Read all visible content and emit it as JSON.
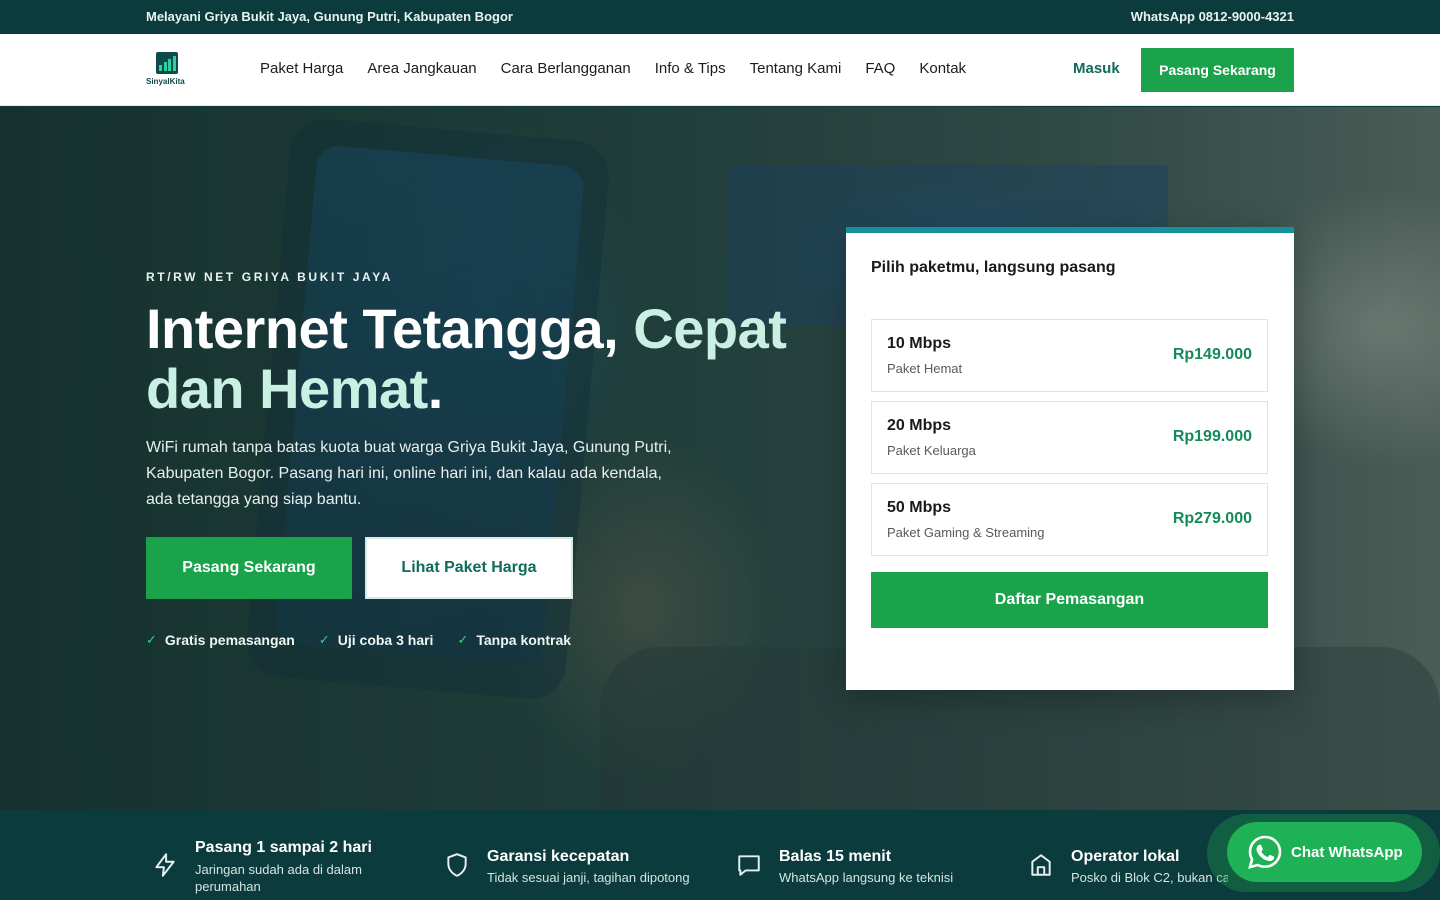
{
  "topbar": {
    "location": "Melayani Griya Bukit Jaya, Gunung Putri, Kabupaten Bogor",
    "contact": "WhatsApp 0812-9000-4321"
  },
  "header": {
    "brand": "SinyalKita",
    "nav": [
      "Paket Harga",
      "Area Jangkauan",
      "Cara Berlangganan",
      "Info & Tips",
      "Tentang Kami",
      "FAQ",
      "Kontak"
    ],
    "login_label": "Masuk",
    "cta_label": "Pasang Sekarang"
  },
  "hero": {
    "eyebrow": "RT/RW NET GRIYA BUKIT JAYA",
    "headline_a": "Internet Tetangga",
    "headline_comma": ",",
    "headline_accent": "Cepat",
    "headline_b": "dan Hemat",
    "headline_dot": ".",
    "lead": "WiFi rumah tanpa batas kuota buat warga Griya Bukit Jaya, Gunung Putri, Kabupaten Bogor. Pasang hari ini, online hari ini, dan kalau ada kendala, ada tetangga yang siap bantu.",
    "primary_cta": "Pasang Sekarang",
    "secondary_cta": "Lihat Paket Harga",
    "checks": [
      "Gratis pemasangan",
      "Uji coba 3 hari",
      "Tanpa kontrak"
    ]
  },
  "plans_card": {
    "title": "Pilih paketmu, langsung pasang",
    "plans": [
      {
        "speed": "10 Mbps",
        "name": "Paket Hemat",
        "price": "Rp149.000"
      },
      {
        "speed": "20 Mbps",
        "name": "Paket Keluarga",
        "price": "Rp199.000"
      },
      {
        "speed": "50 Mbps",
        "name": "Paket Gaming & Streaming",
        "price": "Rp279.000"
      }
    ],
    "cta": "Daftar Pemasangan"
  },
  "features": [
    {
      "icon": "lightning-icon",
      "title": "Pasang 1 sampai 2 hari",
      "desc": "Jaringan sudah ada di dalam perumahan"
    },
    {
      "icon": "shield-icon",
      "title": "Garansi kecepatan",
      "desc": "Tidak sesuai janji, tagihan dipotong"
    },
    {
      "icon": "chat-bubble-icon",
      "title": "Balas 15 menit",
      "desc": "WhatsApp langsung ke teknisi"
    },
    {
      "icon": "home-icon",
      "title": "Operator lokal",
      "desc": "Posko di Blok C2, bukan call"
    }
  ],
  "whatsapp": {
    "label": "Chat WhatsApp",
    "icon": "whatsapp-icon"
  },
  "colors": {
    "primary_green": "#1aa34a",
    "dark_teal": "#0c3b3d",
    "accent_mint": "#c9f0e3",
    "price_green": "#138a59",
    "card_border": "#17909a"
  }
}
